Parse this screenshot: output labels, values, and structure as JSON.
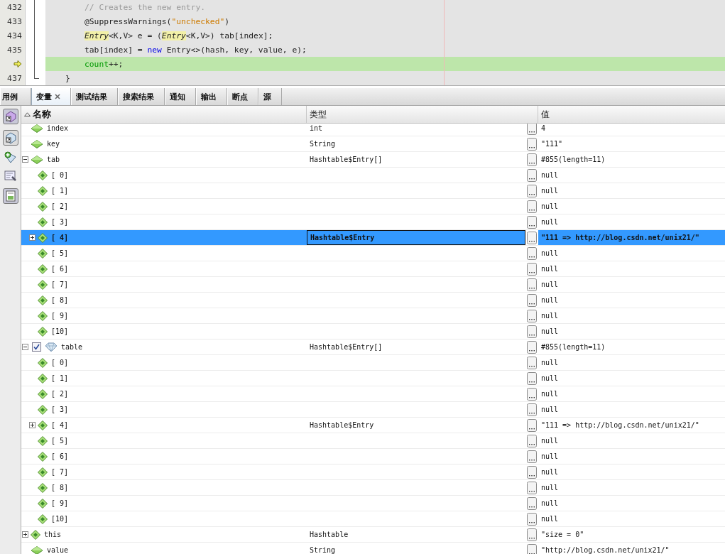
{
  "editor": {
    "lines": [
      {
        "number": "432",
        "current": false,
        "kind": "body",
        "tokens": [
          {
            "text": "// Creates the new entry.",
            "kind": "comment"
          }
        ]
      },
      {
        "number": "433",
        "current": false,
        "kind": "body",
        "tokens": [
          {
            "text": "@SuppressWarnings(",
            "kind": "plain"
          },
          {
            "text": "\"unchecked\"",
            "kind": "string"
          },
          {
            "text": ")",
            "kind": "plain"
          }
        ]
      },
      {
        "number": "434",
        "current": false,
        "kind": "body",
        "tokens": [
          {
            "text": "Entry",
            "kind": "type-mark"
          },
          {
            "text": "<K,V> e = (",
            "kind": "plain"
          },
          {
            "text": "Entry",
            "kind": "type-mark"
          },
          {
            "text": "<K,V>) tab[index];",
            "kind": "plain"
          }
        ]
      },
      {
        "number": "435",
        "current": false,
        "kind": "body",
        "tokens": [
          {
            "text": "tab[index] = ",
            "kind": "plain"
          },
          {
            "text": "new",
            "kind": "keyword"
          },
          {
            "text": " Entry<>(hash, key, value, e);",
            "kind": "plain"
          }
        ]
      },
      {
        "current": true,
        "kind": "body",
        "tokens": [
          {
            "text": "count",
            "kind": "field"
          },
          {
            "text": "++;",
            "kind": "plain"
          }
        ]
      },
      {
        "number": "437",
        "current": false,
        "kind": "brace",
        "tokens": [
          {
            "text": "}",
            "kind": "plain"
          }
        ]
      }
    ]
  },
  "tabs": [
    {
      "label": "用例",
      "selected": false
    },
    {
      "label": "变量",
      "selected": true
    },
    {
      "label": "测试结果",
      "selected": false
    },
    {
      "label": "搜索结果",
      "selected": false
    },
    {
      "label": "通知",
      "selected": false
    },
    {
      "label": "输出",
      "selected": false
    },
    {
      "label": "断点",
      "selected": false
    },
    {
      "label": "源",
      "selected": false
    }
  ],
  "table": {
    "columns": [
      "名称",
      "类型",
      "值"
    ],
    "rows": [
      {
        "name": "index",
        "kind": "local",
        "type": "int",
        "value": "4",
        "selected": false
      },
      {
        "name": "key",
        "kind": "local",
        "type": "String",
        "value": "\"111\"",
        "selected": false
      },
      {
        "name": "tab",
        "kind": "local",
        "type": "Hashtable$Entry[]",
        "value": "#855(length=11)",
        "selected": false,
        "expanded": true,
        "children": [
          {
            "name": "[ 0]",
            "kind": "element",
            "value": "null",
            "selected": false
          },
          {
            "name": "[ 1]",
            "kind": "element",
            "value": "null",
            "selected": false
          },
          {
            "name": "[ 2]",
            "kind": "element",
            "value": "null",
            "selected": false
          },
          {
            "name": "[ 3]",
            "kind": "element",
            "value": "null",
            "selected": false
          },
          {
            "name": "[ 4]",
            "kind": "element",
            "type": "Hashtable$Entry",
            "value": "\"111 => http://blog.csdn.net/unix21/\"",
            "selected": true,
            "expanded": false
          },
          {
            "name": "[ 5]",
            "kind": "element",
            "value": "null",
            "selected": false
          },
          {
            "name": "[ 6]",
            "kind": "element",
            "value": "null",
            "selected": false
          },
          {
            "name": "[ 7]",
            "kind": "element",
            "value": "null",
            "selected": false
          },
          {
            "name": "[ 8]",
            "kind": "element",
            "value": "null",
            "selected": false
          },
          {
            "name": "[ 9]",
            "kind": "element",
            "value": "null",
            "selected": false
          },
          {
            "name": "[10]",
            "kind": "element",
            "value": "null",
            "selected": false
          }
        ]
      },
      {
        "name": "table",
        "kind": "watch",
        "checked": true,
        "type": "Hashtable$Entry[]",
        "value": "#855(length=11)",
        "selected": false,
        "expanded": true,
        "children": [
          {
            "name": "[ 0]",
            "kind": "element",
            "value": "null",
            "selected": false
          },
          {
            "name": "[ 1]",
            "kind": "element",
            "value": "null",
            "selected": false
          },
          {
            "name": "[ 2]",
            "kind": "element",
            "value": "null",
            "selected": false
          },
          {
            "name": "[ 3]",
            "kind": "element",
            "value": "null",
            "selected": false
          },
          {
            "name": "[ 4]",
            "kind": "element",
            "type": "Hashtable$Entry",
            "value": "\"111 => http://blog.csdn.net/unix21/\"",
            "selected": false,
            "expanded": false
          },
          {
            "name": "[ 5]",
            "kind": "element",
            "value": "null",
            "selected": false
          },
          {
            "name": "[ 6]",
            "kind": "element",
            "value": "null",
            "selected": false
          },
          {
            "name": "[ 7]",
            "kind": "element",
            "value": "null",
            "selected": false
          },
          {
            "name": "[ 8]",
            "kind": "element",
            "value": "null",
            "selected": false
          },
          {
            "name": "[ 9]",
            "kind": "element",
            "value": "null",
            "selected": false
          },
          {
            "name": "[10]",
            "kind": "element",
            "value": "null",
            "selected": false
          }
        ]
      },
      {
        "name": "this",
        "kind": "element",
        "type": "Hashtable",
        "value": "\"size = 0\"",
        "selected": false,
        "expanded": false
      },
      {
        "name": "value",
        "kind": "local",
        "type": "String",
        "value": "\"http://blog.csdn.net/unix21/\"",
        "selected": false
      }
    ]
  }
}
